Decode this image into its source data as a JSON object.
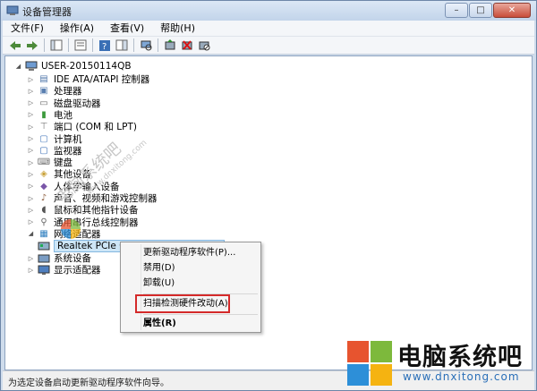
{
  "window": {
    "title": "设备管理器",
    "minimize": "–",
    "maximize": "□",
    "close": "✕"
  },
  "menu": [
    "文件(F)",
    "操作(A)",
    "查看(V)",
    "帮助(H)"
  ],
  "tree": {
    "root": "USER-20150114QB",
    "categories": [
      {
        "label": "IDE ATA/ATAPI 控制器",
        "icon": "ide-controller-icon"
      },
      {
        "label": "处理器",
        "icon": "processor-icon"
      },
      {
        "label": "磁盘驱动器",
        "icon": "disk-drive-icon"
      },
      {
        "label": "电池",
        "icon": "battery-icon"
      },
      {
        "label": "端口 (COM 和 LPT)",
        "icon": "port-icon"
      },
      {
        "label": "计算机",
        "icon": "computer-icon"
      },
      {
        "label": "监视器",
        "icon": "monitor-icon"
      },
      {
        "label": "键盘",
        "icon": "keyboard-icon"
      },
      {
        "label": "其他设备",
        "icon": "other-devices-icon"
      },
      {
        "label": "人体学输入设备",
        "icon": "hid-icon"
      },
      {
        "label": "声音、视频和游戏控制器",
        "icon": "sound-icon"
      },
      {
        "label": "鼠标和其他指针设备",
        "icon": "mouse-icon"
      },
      {
        "label": "通用串行总线控制器",
        "icon": "usb-icon"
      },
      {
        "label": "网络适配器",
        "icon": "network-adapter-icon"
      }
    ],
    "network_child": "Realtek PCIe GBE Family Controller",
    "after": [
      {
        "label": "系统设备",
        "icon": "system-devices-icon"
      },
      {
        "label": "显示适配器",
        "icon": "display-adapter-icon"
      }
    ]
  },
  "context_menu": {
    "update_driver": "更新驱动程序软件(P)...",
    "disable": "禁用(D)",
    "uninstall": "卸载(U)",
    "scan": "扫描检测硬件改动(A)",
    "properties": "属性(R)"
  },
  "status_text": "为选定设备启动更新驱动程序软件向导。",
  "watermark": {
    "name": "电脑系统吧",
    "url": "www.dnxitong.com"
  },
  "brand": {
    "name": "电脑系统吧",
    "url": "www.dnxitong.com"
  },
  "colors": {
    "highlight": "#d42a2a",
    "selection": "#cde6f7",
    "brand_blue": "#2a6fb8"
  }
}
